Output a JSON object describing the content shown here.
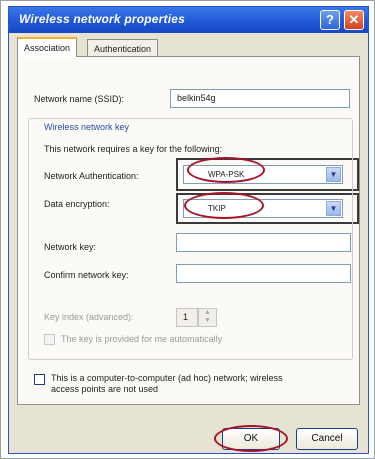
{
  "window": {
    "title": "Wireless network properties"
  },
  "titlebar_buttons": {
    "help": "?",
    "close": "✕"
  },
  "tabs": [
    {
      "label": "Association"
    },
    {
      "label": "Authentication"
    }
  ],
  "ssid": {
    "label": "Network name (SSID):",
    "value": "belkin54g"
  },
  "group": {
    "title": "Wireless network key",
    "description": "This network requires a key for the following:"
  },
  "auth": {
    "label": "Network Authentication:",
    "value": "WPA-PSK"
  },
  "encryption": {
    "label": "Data encryption:",
    "value": "TKIP"
  },
  "network_key": {
    "label": "Network key:",
    "value": ""
  },
  "confirm_key": {
    "label": "Confirm network key:",
    "value": ""
  },
  "key_index": {
    "label": "Key index (advanced):",
    "value": "1"
  },
  "auto_key": {
    "label": "The key is provided for me automatically"
  },
  "adhoc": {
    "line1": "This is a computer-to-computer (ad hoc) network; wireless",
    "line2": "access points are not used"
  },
  "buttons": {
    "ok": "OK",
    "cancel": "Cancel"
  },
  "colors": {
    "title_bar": "#1f56d6",
    "dialog_bg": "#e7e3d3",
    "annotation": "#a6142a"
  }
}
